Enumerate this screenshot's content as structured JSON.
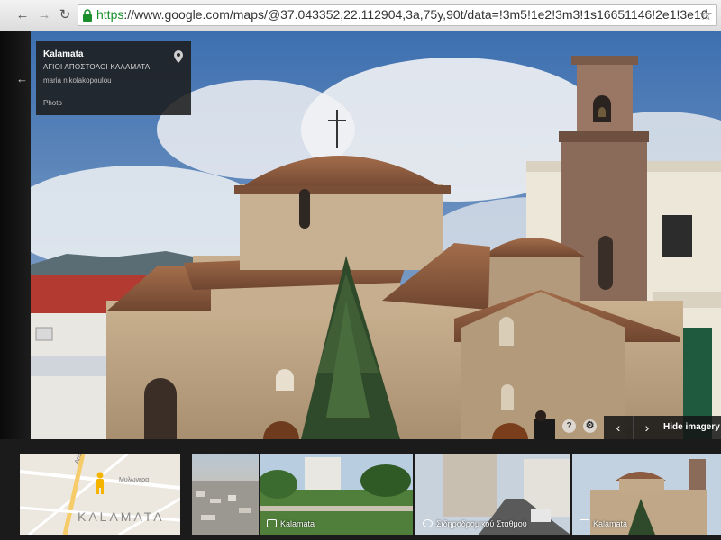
{
  "browser": {
    "url_scheme": "https",
    "url_rest": "://www.google.com/maps/@37.043352,22.112904,3a,75y,90t/data=!3m5!1e2!3m3!1s16651146!2e1!3e10"
  },
  "info_card": {
    "title": "Kalamata",
    "subtitle": "ΑΓΙΟΙ ΑΠΟΣΤΟΛΟΙ ΚΑΛΑΜΑΤΑ",
    "author": "maria nikolakopoulou",
    "type": "Photo"
  },
  "controls": {
    "help": "?",
    "hide_imagery": "Hide imagery",
    "prev": "‹",
    "next": "›"
  },
  "map_thumb": {
    "street1": "Aristomenous",
    "street2": "Μυλωνερα",
    "city": "KALAMATA"
  },
  "thumbnails": [
    {
      "label": "Kalamata"
    },
    {
      "label": "Σιδηροδρομικού Σταθμού"
    },
    {
      "label": "Kalamata"
    }
  ],
  "colors": {
    "accent_green": "#1a8f2c",
    "map_bg": "#e9e5dc",
    "pegman": "#f5b400"
  }
}
